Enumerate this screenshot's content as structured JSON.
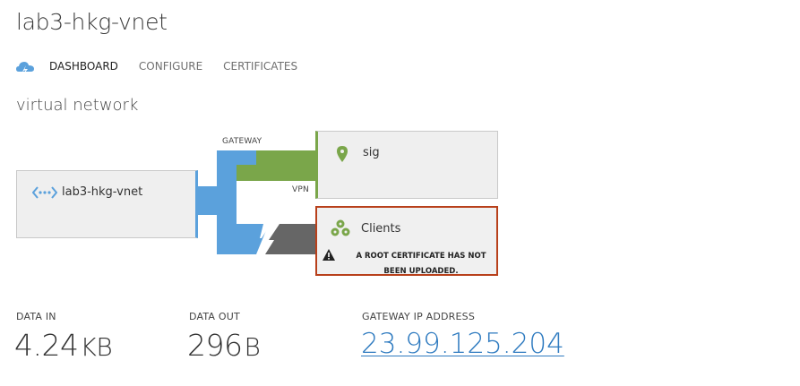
{
  "page": {
    "title": "lab3-hkg-vnet"
  },
  "tabs": [
    {
      "label": "DASHBOARD",
      "active": true
    },
    {
      "label": "CONFIGURE",
      "active": false
    },
    {
      "label": "CERTIFICATES",
      "active": false
    }
  ],
  "diagram": {
    "heading": "virtual network",
    "gateway_label": "GATEWAY",
    "vpn_label": "VPN",
    "vnet": {
      "label": "lab3-hkg-vnet",
      "icon": "network-icon"
    },
    "site": {
      "label": "sig",
      "icon": "location-pin-icon"
    },
    "clients": {
      "label": "Clients",
      "icon": "clients-icon",
      "warning": "A ROOT CERTIFICATE HAS NOT BEEN UPLOADED."
    }
  },
  "stats": {
    "data_in": {
      "label": "DATA IN",
      "value": "4.24",
      "unit": "KB"
    },
    "data_out": {
      "label": "DATA OUT",
      "value": "296",
      "unit": "B"
    },
    "gateway_ip": {
      "label": "GATEWAY IP ADDRESS",
      "value": "23.99.125.204"
    }
  },
  "colors": {
    "azure_blue": "#5ba1dc",
    "site_green": "#7aa64a",
    "disconnected_gray": "#666666",
    "warning_red": "#b8401b",
    "link_blue": "#2f7bc0"
  }
}
